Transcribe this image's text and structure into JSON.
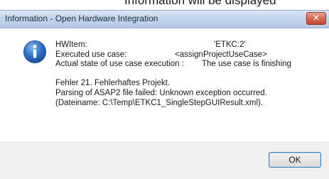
{
  "background_text": "Information will be displayed",
  "dialog": {
    "title": "Information - Open Hardware Integration",
    "close_glyph": "✕",
    "icon": "info-icon",
    "lines": {
      "hwitem_label": "HWItem:",
      "hwitem_value": "'ETKC:2'",
      "executed_label": "Executed use case:",
      "executed_value": "<assignProjectUseCase>",
      "state_label": "Actual state of use case execution :",
      "state_value": "The use case is finishing",
      "error_line1": "Fehler 21. Fehlerhaftes Projekt.",
      "error_line2": "Parsing of ASAP2 file failed: Unknown exception occurred.",
      "error_line3": "(Dateiname:  C:\\Temp\\ETKC1_SingleStepGUIResult.xml)."
    },
    "ok_label": "OK"
  },
  "colors": {
    "titlebar": "#c3d5ec",
    "close_button": "#d66a52",
    "info_icon": "#2b6fc8",
    "footer": "#f0f0f0",
    "ok_border": "#3c7fb1"
  }
}
